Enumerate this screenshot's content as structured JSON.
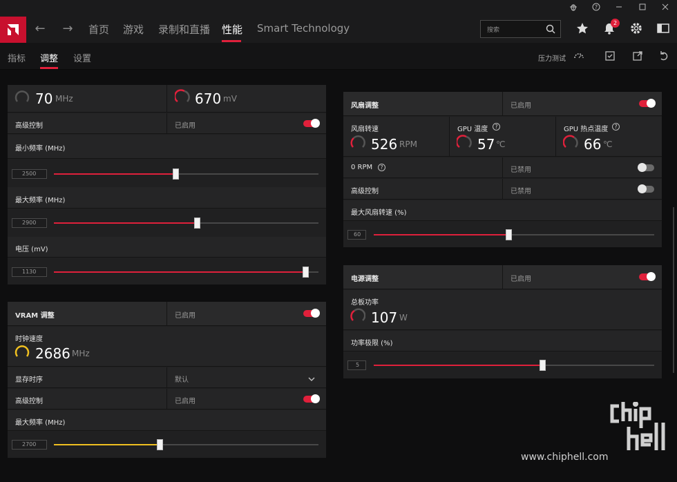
{
  "colors": {
    "accent": "#e0203b",
    "vram_accent": "#f0c020",
    "panel": "#202021"
  },
  "titlebar": {
    "icons": [
      "bug-icon",
      "help-icon",
      "minimize-icon",
      "maximize-icon",
      "close-icon"
    ]
  },
  "nav": {
    "items": [
      "首页",
      "游戏",
      "录制和直播",
      "性能",
      "Smart Technology"
    ],
    "active": "性能",
    "search_placeholder": "搜索",
    "notification_count": "2"
  },
  "subnav": {
    "items": [
      "指标",
      "调整",
      "设置"
    ],
    "active": "调整",
    "stress_test_label": "压力测试"
  },
  "gpu_tuning": {
    "clock_value": "70",
    "clock_unit": "MHz",
    "voltage_value": "670",
    "voltage_unit": "mV",
    "advanced_label": "高级控制",
    "advanced_status": "已启用",
    "min_freq_label": "最小频率 (MHz)",
    "min_freq_value": "2500",
    "min_freq_fraction": 0.46,
    "max_freq_label": "最大频率 (MHz)",
    "max_freq_value": "2900",
    "max_freq_fraction": 0.54,
    "voltage_label": "电压 (mV)",
    "voltage_setting": "1130",
    "voltage_fraction": 0.95
  },
  "vram": {
    "title": "VRAM 调整",
    "status": "已启用",
    "clock_label": "时钟速度",
    "clock_value": "2686",
    "clock_unit": "MHz",
    "timing_label": "显存时序",
    "timing_value": "默认",
    "advanced_label": "高级控制",
    "advanced_status": "已启用",
    "max_freq_label": "最大频率 (MHz)",
    "max_freq_value": "2700",
    "max_freq_fraction": 0.4
  },
  "fan": {
    "title": "风扇调整",
    "status": "已启用",
    "speed_label": "风扇转速",
    "speed_value": "526",
    "speed_unit": "RPM",
    "gpu_temp_label": "GPU 温度",
    "gpu_temp_value": "57",
    "temp_unit": "℃",
    "hotspot_label": "GPU 热点温度",
    "hotspot_value": "66",
    "zero_rpm_label": "0 RPM",
    "zero_rpm_status": "已禁用",
    "advanced_label": "高级控制",
    "advanced_status": "已禁用",
    "max_speed_label": "最大风扇转速 (%)",
    "max_speed_value": "60",
    "max_speed_fraction": 0.48
  },
  "power": {
    "title": "电源调整",
    "status": "已启用",
    "board_power_label": "总板功率",
    "board_power_value": "107",
    "board_power_unit": "W",
    "limit_label": "功率极限 (%)",
    "limit_value": "5",
    "limit_fraction": 0.6
  },
  "watermark": {
    "text": "www.chiphell.com"
  }
}
